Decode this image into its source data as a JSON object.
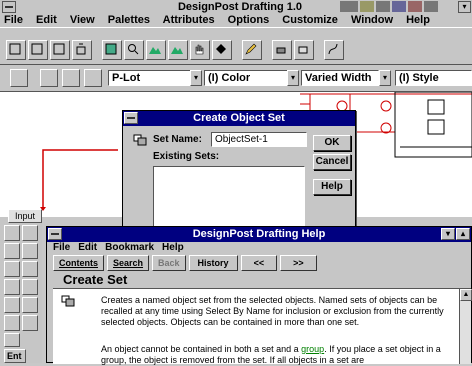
{
  "app": {
    "title": "DesignPost Drafting 1.0",
    "menu": [
      "File",
      "Edit",
      "View",
      "Palettes",
      "Attributes",
      "Options",
      "Customize",
      "Window",
      "Help"
    ]
  },
  "attr_bar": {
    "layer": "P-Lot",
    "color": "(I) Color",
    "width": "Varied Width",
    "style": "(I) Style"
  },
  "dialog": {
    "title": "Create Object Set",
    "set_name_label": "Set Name:",
    "set_name_value": "ObjectSet-1",
    "existing_label": "Existing Sets:",
    "ok": "OK",
    "cancel": "Cancel",
    "help": "Help"
  },
  "input_tab": "Input",
  "left_label": "Ent",
  "help": {
    "title": "DesignPost Drafting Help",
    "menu": [
      "File",
      "Edit",
      "Bookmark",
      "Help"
    ],
    "buttons": [
      "Contents",
      "Search",
      "Back",
      "History",
      "<<",
      ">>"
    ],
    "heading": "Create Set",
    "para1": "Creates a named object set from the selected objects.  Named sets of objects can be recalled at any time using Select By Name for inclusion or exclusion from the currently selected objects.  Objects can be contained in more than one set.",
    "para2_a": "An object cannot be contained in both a set and a ",
    "para2_link": "group",
    "para2_b": ".  If you place a set object in a group, the object is removed from the set.  If all objects in a set are"
  },
  "colors": {
    "titlebar": "#000080",
    "accent_red": "#d00000",
    "link": "#008000"
  }
}
